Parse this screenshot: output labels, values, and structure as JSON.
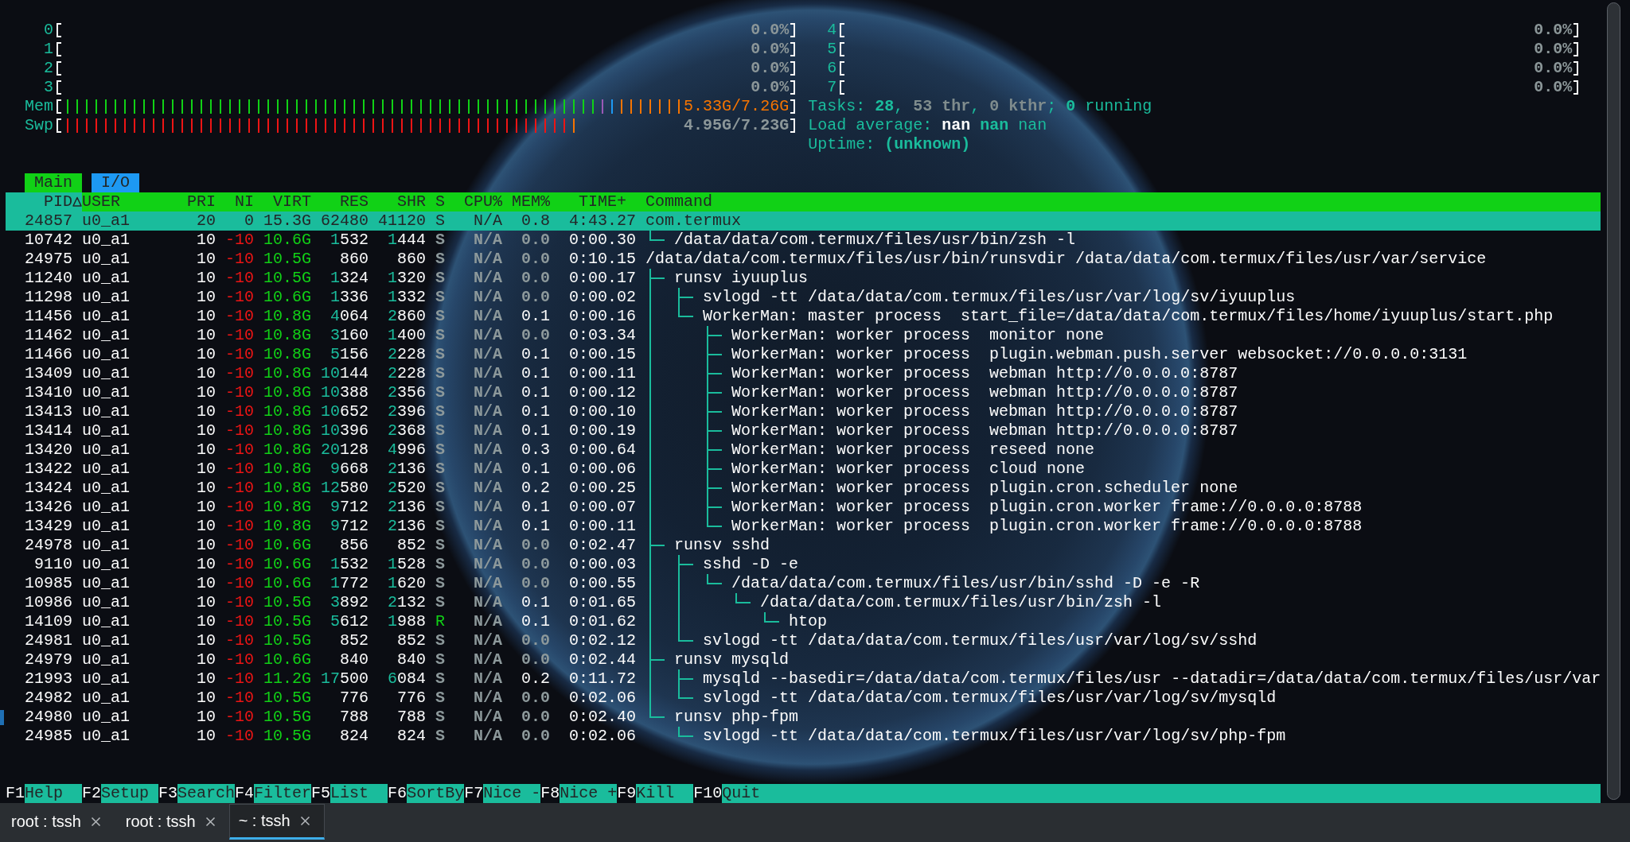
{
  "meters": {
    "cpus": [
      {
        "label": "0",
        "reading": "0.0%",
        "level": 0
      },
      {
        "label": "1",
        "reading": "0.0%",
        "level": 0
      },
      {
        "label": "2",
        "reading": "0.0%",
        "level": 0
      },
      {
        "label": "3",
        "reading": "0.0%",
        "level": 0
      },
      {
        "label": "4",
        "reading": "0.0%",
        "level": 0
      },
      {
        "label": "5",
        "reading": "0.0%",
        "level": 0
      },
      {
        "label": "6",
        "reading": "0.0%",
        "level": 0
      },
      {
        "label": "7",
        "reading": "0.0%",
        "level": 0
      }
    ],
    "memory": {
      "label": "Mem",
      "reading": "5.33G/7.26G",
      "segments": [
        {
          "color": "#11d116",
          "level": 0.731
        },
        {
          "color": "#9b59b6",
          "level": 0.744
        },
        {
          "color": "#1d99f3",
          "level": 0.756
        },
        {
          "color": "#f67400",
          "level": 0.846
        }
      ]
    },
    "swap": {
      "label": "Swp",
      "reading": "4.95G/7.23G",
      "segments": [
        {
          "color": "#ed1515",
          "level": 0.692
        },
        {
          "color": "#f67400",
          "level": 0.705
        }
      ]
    },
    "tasks": {
      "parts": [
        {
          "text": "Tasks: ",
          "kind": "label"
        },
        {
          "text": "28",
          "kind": "value"
        },
        {
          "text": ", ",
          "kind": "label"
        },
        {
          "text": "53 thr",
          "kind": "shadow"
        },
        {
          "text": ", ",
          "kind": "label"
        },
        {
          "text": "0 kthr",
          "kind": "shadow"
        },
        {
          "text": "; ",
          "kind": "label"
        },
        {
          "text": "0",
          "kind": "value"
        },
        {
          "text": " running",
          "kind": "label"
        }
      ]
    },
    "load_average": {
      "parts": [
        {
          "text": "Load average: ",
          "kind": "label"
        },
        {
          "text": "nan ",
          "kind": "bright"
        },
        {
          "text": "nan ",
          "kind": "value"
        },
        {
          "text": "nan",
          "kind": "label"
        }
      ]
    },
    "uptime": {
      "parts": [
        {
          "text": "Uptime: ",
          "kind": "label"
        },
        {
          "text": "(unknown)",
          "kind": "value"
        }
      ]
    }
  },
  "screen_tabs": [
    {
      "label": "Main",
      "selected": true
    },
    {
      "label": "I/O",
      "selected": false
    }
  ],
  "process_table": {
    "columns": [
      {
        "label": "PID",
        "kind": "pid",
        "sorted": true
      },
      {
        "label": "USER",
        "kind": "user",
        "sorted": false
      },
      {
        "label": "PRI",
        "kind": "priority",
        "sorted": false
      },
      {
        "label": "NI",
        "kind": "nice",
        "sorted": false
      },
      {
        "label": "VIRT",
        "kind": "virt",
        "sorted": false
      },
      {
        "label": "RES",
        "kind": "res",
        "sorted": false
      },
      {
        "label": "SHR",
        "kind": "shr",
        "sorted": false
      },
      {
        "label": "S",
        "kind": "state",
        "sorted": false
      },
      {
        "label": "CPU%",
        "kind": "cpu",
        "sorted": false
      },
      {
        "label": "MEM%",
        "kind": "mem",
        "sorted": false
      },
      {
        "label": "TIME+",
        "kind": "time",
        "sorted": false
      },
      {
        "label": "Command",
        "kind": "command",
        "sorted": false
      }
    ],
    "rows": [
      {
        "pid": "24857",
        "user": "u0_a1",
        "priority": "20",
        "nice": "0",
        "virt": "15.3G",
        "res": "62480",
        "shr": "41120",
        "state": "S",
        "running": false,
        "cpu": "N/A",
        "mem": "0.8",
        "time": "4:43.27",
        "command": "com.termux",
        "selected": true,
        "marked": false,
        "children": [
          {
            "pid": "10742",
            "user": "u0_a1",
            "priority": "10",
            "nice": "-10",
            "virt": "10.6G",
            "res": "1532",
            "shr": "1444",
            "state": "S",
            "running": false,
            "cpu": "N/A",
            "mem": "0.0",
            "time": "0:00.30",
            "command": "/data/data/com.termux/files/usr/bin/zsh -l",
            "selected": false,
            "marked": false
          }
        ]
      },
      {
        "pid": "24975",
        "user": "u0_a1",
        "priority": "10",
        "nice": "-10",
        "virt": "10.5G",
        "res": "860",
        "shr": "860",
        "state": "S",
        "running": false,
        "cpu": "N/A",
        "mem": "0.0",
        "time": "0:10.15",
        "command": "/data/data/com.termux/files/usr/bin/runsvdir /data/data/com.termux/files/usr/var/service",
        "selected": false,
        "marked": false,
        "children": [
          {
            "pid": "11240",
            "user": "u0_a1",
            "priority": "10",
            "nice": "-10",
            "virt": "10.5G",
            "res": "1324",
            "shr": "1320",
            "state": "S",
            "running": false,
            "cpu": "N/A",
            "mem": "0.0",
            "time": "0:00.17",
            "command": "runsv iyuuplus",
            "selected": false,
            "marked": false,
            "children": [
              {
                "pid": "11298",
                "user": "u0_a1",
                "priority": "10",
                "nice": "-10",
                "virt": "10.6G",
                "res": "1336",
                "shr": "1332",
                "state": "S",
                "running": false,
                "cpu": "N/A",
                "mem": "0.0",
                "time": "0:00.02",
                "command": "svlogd -tt /data/data/com.termux/files/usr/var/log/sv/iyuuplus",
                "selected": false,
                "marked": false
              },
              {
                "pid": "11456",
                "user": "u0_a1",
                "priority": "10",
                "nice": "-10",
                "virt": "10.8G",
                "res": "4064",
                "shr": "2860",
                "state": "S",
                "running": false,
                "cpu": "N/A",
                "mem": "0.1",
                "time": "0:00.16",
                "command": "WorkerMan: master process  start_file=/data/data/com.termux/files/home/iyuuplus/start.php",
                "selected": false,
                "marked": false,
                "children": [
                  {
                    "pid": "11462",
                    "user": "u0_a1",
                    "priority": "10",
                    "nice": "-10",
                    "virt": "10.8G",
                    "res": "3160",
                    "shr": "1400",
                    "state": "S",
                    "running": false,
                    "cpu": "N/A",
                    "mem": "0.0",
                    "time": "0:03.34",
                    "command": "WorkerMan: worker process  monitor none",
                    "selected": false,
                    "marked": false
                  },
                  {
                    "pid": "11466",
                    "user": "u0_a1",
                    "priority": "10",
                    "nice": "-10",
                    "virt": "10.8G",
                    "res": "5156",
                    "shr": "2228",
                    "state": "S",
                    "running": false,
                    "cpu": "N/A",
                    "mem": "0.1",
                    "time": "0:00.15",
                    "command": "WorkerMan: worker process  plugin.webman.push.server websocket://0.0.0.0:3131",
                    "selected": false,
                    "marked": false
                  },
                  {
                    "pid": "13409",
                    "user": "u0_a1",
                    "priority": "10",
                    "nice": "-10",
                    "virt": "10.8G",
                    "res": "10144",
                    "shr": "2228",
                    "state": "S",
                    "running": false,
                    "cpu": "N/A",
                    "mem": "0.1",
                    "time": "0:00.11",
                    "command": "WorkerMan: worker process  webman http://0.0.0.0:8787",
                    "selected": false,
                    "marked": false
                  },
                  {
                    "pid": "13410",
                    "user": "u0_a1",
                    "priority": "10",
                    "nice": "-10",
                    "virt": "10.8G",
                    "res": "10388",
                    "shr": "2356",
                    "state": "S",
                    "running": false,
                    "cpu": "N/A",
                    "mem": "0.1",
                    "time": "0:00.12",
                    "command": "WorkerMan: worker process  webman http://0.0.0.0:8787",
                    "selected": false,
                    "marked": false
                  },
                  {
                    "pid": "13413",
                    "user": "u0_a1",
                    "priority": "10",
                    "nice": "-10",
                    "virt": "10.8G",
                    "res": "10652",
                    "shr": "2396",
                    "state": "S",
                    "running": false,
                    "cpu": "N/A",
                    "mem": "0.1",
                    "time": "0:00.10",
                    "command": "WorkerMan: worker process  webman http://0.0.0.0:8787",
                    "selected": false,
                    "marked": false
                  },
                  {
                    "pid": "13414",
                    "user": "u0_a1",
                    "priority": "10",
                    "nice": "-10",
                    "virt": "10.8G",
                    "res": "10396",
                    "shr": "2368",
                    "state": "S",
                    "running": false,
                    "cpu": "N/A",
                    "mem": "0.1",
                    "time": "0:00.19",
                    "command": "WorkerMan: worker process  webman http://0.0.0.0:8787",
                    "selected": false,
                    "marked": false
                  },
                  {
                    "pid": "13420",
                    "user": "u0_a1",
                    "priority": "10",
                    "nice": "-10",
                    "virt": "10.8G",
                    "res": "20128",
                    "shr": "4996",
                    "state": "S",
                    "running": false,
                    "cpu": "N/A",
                    "mem": "0.3",
                    "time": "0:00.64",
                    "command": "WorkerMan: worker process  reseed none",
                    "selected": false,
                    "marked": false
                  },
                  {
                    "pid": "13422",
                    "user": "u0_a1",
                    "priority": "10",
                    "nice": "-10",
                    "virt": "10.8G",
                    "res": "9668",
                    "shr": "2136",
                    "state": "S",
                    "running": false,
                    "cpu": "N/A",
                    "mem": "0.1",
                    "time": "0:00.06",
                    "command": "WorkerMan: worker process  cloud none",
                    "selected": false,
                    "marked": false
                  },
                  {
                    "pid": "13424",
                    "user": "u0_a1",
                    "priority": "10",
                    "nice": "-10",
                    "virt": "10.8G",
                    "res": "12580",
                    "shr": "2520",
                    "state": "S",
                    "running": false,
                    "cpu": "N/A",
                    "mem": "0.2",
                    "time": "0:00.25",
                    "command": "WorkerMan: worker process  plugin.cron.scheduler none",
                    "selected": false,
                    "marked": false
                  },
                  {
                    "pid": "13426",
                    "user": "u0_a1",
                    "priority": "10",
                    "nice": "-10",
                    "virt": "10.8G",
                    "res": "9712",
                    "shr": "2136",
                    "state": "S",
                    "running": false,
                    "cpu": "N/A",
                    "mem": "0.1",
                    "time": "0:00.07",
                    "command": "WorkerMan: worker process  plugin.cron.worker frame://0.0.0.0:8788",
                    "selected": false,
                    "marked": false
                  },
                  {
                    "pid": "13429",
                    "user": "u0_a1",
                    "priority": "10",
                    "nice": "-10",
                    "virt": "10.8G",
                    "res": "9712",
                    "shr": "2136",
                    "state": "S",
                    "running": false,
                    "cpu": "N/A",
                    "mem": "0.1",
                    "time": "0:00.11",
                    "command": "WorkerMan: worker process  plugin.cron.worker frame://0.0.0.0:8788",
                    "selected": false,
                    "marked": false
                  }
                ]
              }
            ]
          },
          {
            "pid": "24978",
            "user": "u0_a1",
            "priority": "10",
            "nice": "-10",
            "virt": "10.6G",
            "res": "856",
            "shr": "852",
            "state": "S",
            "running": false,
            "cpu": "N/A",
            "mem": "0.0",
            "time": "0:02.47",
            "command": "runsv sshd",
            "selected": false,
            "marked": false,
            "children": [
              {
                "pid": "9110",
                "user": "u0_a1",
                "priority": "10",
                "nice": "-10",
                "virt": "10.6G",
                "res": "1532",
                "shr": "1528",
                "state": "S",
                "running": false,
                "cpu": "N/A",
                "mem": "0.0",
                "time": "0:00.03",
                "command": "sshd -D -e",
                "selected": false,
                "marked": false,
                "children": [
                  {
                    "pid": "10985",
                    "user": "u0_a1",
                    "priority": "10",
                    "nice": "-10",
                    "virt": "10.6G",
                    "res": "1772",
                    "shr": "1620",
                    "state": "S",
                    "running": false,
                    "cpu": "N/A",
                    "mem": "0.0",
                    "time": "0:00.55",
                    "command": "/data/data/com.termux/files/usr/bin/sshd -D -e -R",
                    "selected": false,
                    "marked": false,
                    "children": [
                      {
                        "pid": "10986",
                        "user": "u0_a1",
                        "priority": "10",
                        "nice": "-10",
                        "virt": "10.5G",
                        "res": "3892",
                        "shr": "2132",
                        "state": "S",
                        "running": false,
                        "cpu": "N/A",
                        "mem": "0.1",
                        "time": "0:01.65",
                        "command": "/data/data/com.termux/files/usr/bin/zsh -l",
                        "selected": false,
                        "marked": false,
                        "children": [
                          {
                            "pid": "14109",
                            "user": "u0_a1",
                            "priority": "10",
                            "nice": "-10",
                            "virt": "10.5G",
                            "res": "5612",
                            "shr": "1988",
                            "state": "R",
                            "running": true,
                            "cpu": "N/A",
                            "mem": "0.1",
                            "time": "0:01.62",
                            "command": "htop",
                            "selected": false,
                            "marked": false
                          }
                        ]
                      }
                    ]
                  }
                ]
              },
              {
                "pid": "24981",
                "user": "u0_a1",
                "priority": "10",
                "nice": "-10",
                "virt": "10.5G",
                "res": "852",
                "shr": "852",
                "state": "S",
                "running": false,
                "cpu": "N/A",
                "mem": "0.0",
                "time": "0:02.12",
                "command": "svlogd -tt /data/data/com.termux/files/usr/var/log/sv/sshd",
                "selected": false,
                "marked": false
              }
            ]
          },
          {
            "pid": "24979",
            "user": "u0_a1",
            "priority": "10",
            "nice": "-10",
            "virt": "10.6G",
            "res": "840",
            "shr": "840",
            "state": "S",
            "running": false,
            "cpu": "N/A",
            "mem": "0.0",
            "time": "0:02.44",
            "command": "runsv mysqld",
            "selected": false,
            "marked": false,
            "children": [
              {
                "pid": "21993",
                "user": "u0_a1",
                "priority": "10",
                "nice": "-10",
                "virt": "11.2G",
                "res": "17500",
                "shr": "6084",
                "state": "S",
                "running": false,
                "cpu": "N/A",
                "mem": "0.2",
                "time": "0:11.72",
                "command": "mysqld --basedir=/data/data/com.termux/files/usr --datadir=/data/data/com.termux/files/usr/var",
                "selected": false,
                "marked": false
              },
              {
                "pid": "24982",
                "user": "u0_a1",
                "priority": "10",
                "nice": "-10",
                "virt": "10.5G",
                "res": "776",
                "shr": "776",
                "state": "S",
                "running": false,
                "cpu": "N/A",
                "mem": "0.0",
                "time": "0:02.06",
                "command": "svlogd -tt /data/data/com.termux/files/usr/var/log/sv/mysqld",
                "selected": false,
                "marked": false
              }
            ]
          },
          {
            "pid": "24980",
            "user": "u0_a1",
            "priority": "10",
            "nice": "-10",
            "virt": "10.5G",
            "res": "788",
            "shr": "788",
            "state": "S",
            "running": false,
            "cpu": "N/A",
            "mem": "0.0",
            "time": "0:02.40",
            "command": "runsv php-fpm",
            "selected": false,
            "marked": true,
            "children": [
              {
                "pid": "24985",
                "user": "u0_a1",
                "priority": "10",
                "nice": "-10",
                "virt": "10.5G",
                "res": "824",
                "shr": "824",
                "state": "S",
                "running": false,
                "cpu": "N/A",
                "mem": "0.0",
                "time": "0:02.06",
                "command": "svlogd -tt /data/data/com.termux/files/usr/var/log/sv/php-fpm",
                "selected": false,
                "marked": false
              }
            ]
          }
        ]
      }
    ]
  },
  "function_keys": [
    {
      "key": "F1",
      "label": "Help"
    },
    {
      "key": "F2",
      "label": "Setup"
    },
    {
      "key": "F3",
      "label": "Search"
    },
    {
      "key": "F4",
      "label": "Filter"
    },
    {
      "key": "F5",
      "label": "List"
    },
    {
      "key": "F6",
      "label": "SortBy"
    },
    {
      "key": "F7",
      "label": "Nice -"
    },
    {
      "key": "F8",
      "label": "Nice +"
    },
    {
      "key": "F9",
      "label": "Kill"
    },
    {
      "key": "F10",
      "label": "Quit"
    }
  ],
  "terminal_tabs": [
    {
      "title": "root : tssh",
      "selected": false
    },
    {
      "title": "root : tssh",
      "selected": false
    },
    {
      "title": "~ : tssh",
      "selected": true
    }
  ]
}
